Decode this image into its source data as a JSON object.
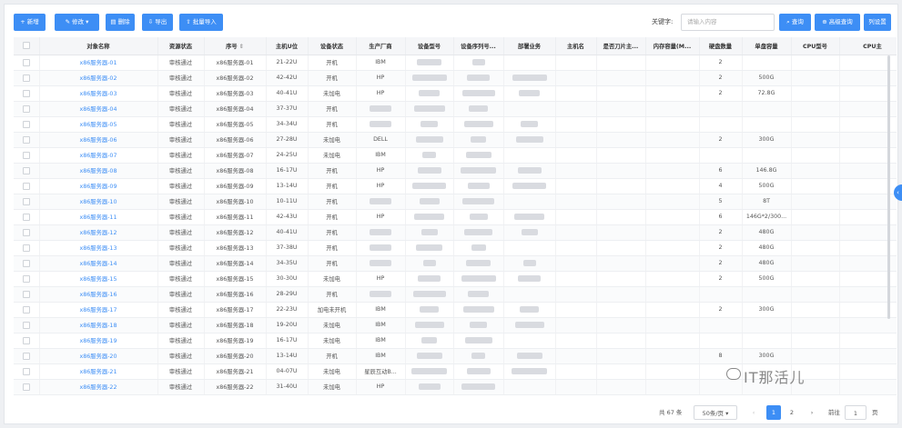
{
  "toolbar": {
    "add": "新增",
    "edit": "修改",
    "delete": "删除",
    "export": "导出",
    "import": "批量导入",
    "keyword_label": "关键字:",
    "keyword_placeholder": "请输入内容",
    "search": "查询",
    "advanced": "高级查询",
    "columns": "列设置"
  },
  "icons": {
    "add": "plus-icon",
    "edit": "edit-icon",
    "delete": "trash-icon",
    "export": "download-icon",
    "import": "upload-icon",
    "search": "search-icon",
    "advanced": "filter-icon",
    "collapse": "chevron-left-icon"
  },
  "accent": "#3d8ef5",
  "columns": [
    "对象名称",
    "资源状态",
    "序号",
    "主机U位",
    "设备状态",
    "生产厂商",
    "设备型号",
    "设备序列号...",
    "部署业务",
    "主机名",
    "是否刀片主...",
    "内存容量(M...",
    "硬盘数量",
    "单盘容量",
    "CPU型号",
    "CPU主"
  ],
  "rows": [
    {
      "name": "x86服务器-01",
      "status": "审核通过",
      "seq": "x86服务器-01",
      "u": "21-22U",
      "dev": "开机",
      "vendor": "IBM",
      "disk_num": "2",
      "disk_cap": ""
    },
    {
      "name": "x86服务器-02",
      "status": "审核通过",
      "seq": "x86服务器-02",
      "u": "42-42U",
      "dev": "开机",
      "vendor": "HP",
      "disk_num": "2",
      "disk_cap": "500G"
    },
    {
      "name": "x86服务器-03",
      "status": "审核通过",
      "seq": "x86服务器-03",
      "u": "40-41U",
      "dev": "未加电",
      "vendor": "HP",
      "disk_num": "2",
      "disk_cap": "72.8G"
    },
    {
      "name": "x86服务器-04",
      "status": "审核通过",
      "seq": "x86服务器-04",
      "u": "37-37U",
      "dev": "开机",
      "vendor": "",
      "disk_num": "",
      "disk_cap": ""
    },
    {
      "name": "x86服务器-05",
      "status": "审核通过",
      "seq": "x86服务器-05",
      "u": "34-34U",
      "dev": "开机",
      "vendor": "",
      "disk_num": "",
      "disk_cap": ""
    },
    {
      "name": "x86服务器-06",
      "status": "审核通过",
      "seq": "x86服务器-06",
      "u": "27-28U",
      "dev": "未加电",
      "vendor": "DELL",
      "disk_num": "2",
      "disk_cap": "300G"
    },
    {
      "name": "x86服务器-07",
      "status": "审核通过",
      "seq": "x86服务器-07",
      "u": "24-25U",
      "dev": "未加电",
      "vendor": "IBM",
      "disk_num": "",
      "disk_cap": ""
    },
    {
      "name": "x86服务器-08",
      "status": "审核通过",
      "seq": "x86服务器-08",
      "u": "16-17U",
      "dev": "开机",
      "vendor": "HP",
      "disk_num": "6",
      "disk_cap": "146.8G"
    },
    {
      "name": "x86服务器-09",
      "status": "审核通过",
      "seq": "x86服务器-09",
      "u": "13-14U",
      "dev": "开机",
      "vendor": "HP",
      "disk_num": "4",
      "disk_cap": "500G"
    },
    {
      "name": "x86服务器-10",
      "status": "审核通过",
      "seq": "x86服务器-10",
      "u": "10-11U",
      "dev": "开机",
      "vendor": "",
      "disk_num": "5",
      "disk_cap": "8T"
    },
    {
      "name": "x86服务器-11",
      "status": "审核通过",
      "seq": "x86服务器-11",
      "u": "42-43U",
      "dev": "开机",
      "vendor": "HP",
      "disk_num": "6",
      "disk_cap": "146G*2/300..."
    },
    {
      "name": "x86服务器-12",
      "status": "审核通过",
      "seq": "x86服务器-12",
      "u": "40-41U",
      "dev": "开机",
      "vendor": "",
      "disk_num": "2",
      "disk_cap": "480G"
    },
    {
      "name": "x86服务器-13",
      "status": "审核通过",
      "seq": "x86服务器-13",
      "u": "37-38U",
      "dev": "开机",
      "vendor": "",
      "disk_num": "2",
      "disk_cap": "480G"
    },
    {
      "name": "x86服务器-14",
      "status": "审核通过",
      "seq": "x86服务器-14",
      "u": "34-35U",
      "dev": "开机",
      "vendor": "",
      "disk_num": "2",
      "disk_cap": "480G"
    },
    {
      "name": "x86服务器-15",
      "status": "审核通过",
      "seq": "x86服务器-15",
      "u": "30-30U",
      "dev": "未加电",
      "vendor": "HP",
      "disk_num": "2",
      "disk_cap": "500G"
    },
    {
      "name": "x86服务器-16",
      "status": "审核通过",
      "seq": "x86服务器-16",
      "u": "28-29U",
      "dev": "开机",
      "vendor": "",
      "disk_num": "",
      "disk_cap": ""
    },
    {
      "name": "x86服务器-17",
      "status": "审核通过",
      "seq": "x86服务器-17",
      "u": "22-23U",
      "dev": "加电未开机",
      "vendor": "IBM",
      "disk_num": "2",
      "disk_cap": "300G"
    },
    {
      "name": "x86服务器-18",
      "status": "审核通过",
      "seq": "x86服务器-18",
      "u": "19-20U",
      "dev": "未加电",
      "vendor": "IBM",
      "disk_num": "",
      "disk_cap": ""
    },
    {
      "name": "x86服务器-19",
      "status": "审核通过",
      "seq": "x86服务器-19",
      "u": "16-17U",
      "dev": "未加电",
      "vendor": "IBM",
      "disk_num": "",
      "disk_cap": ""
    },
    {
      "name": "x86服务器-20",
      "status": "审核通过",
      "seq": "x86服务器-20",
      "u": "13-14U",
      "dev": "开机",
      "vendor": "IBM",
      "disk_num": "8",
      "disk_cap": "300G"
    },
    {
      "name": "x86服务器-21",
      "status": "审核通过",
      "seq": "x86服务器-21",
      "u": "04-07U",
      "dev": "未加电",
      "vendor": "星辰互动B...",
      "disk_num": "",
      "disk_cap": ""
    },
    {
      "name": "x86服务器-22",
      "status": "审核通过",
      "seq": "x86服务器-22",
      "u": "31-40U",
      "dev": "未加电",
      "vendor": "HP",
      "disk_num": "",
      "disk_cap": ""
    }
  ],
  "pagination": {
    "total": "共 67 条",
    "page_size": "50条/页",
    "prev": "‹",
    "pages": [
      "1",
      "2"
    ],
    "next": "›",
    "goto_label": "前往",
    "goto_value": "1",
    "page_unit": "页"
  },
  "watermark": "IT那活儿"
}
